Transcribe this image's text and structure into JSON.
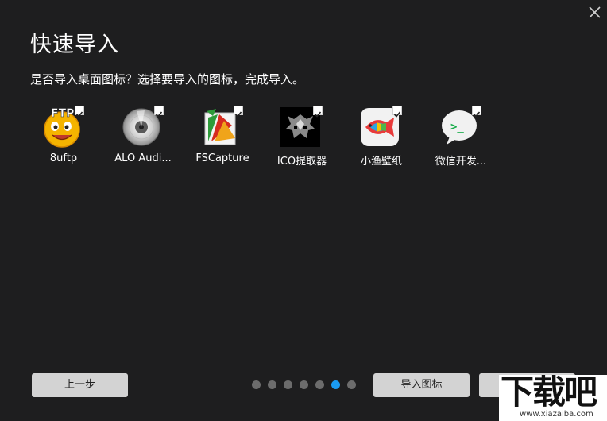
{
  "dialog": {
    "title": "快速导入",
    "subtitle": "是否导入桌面图标？选择要导入的图标，完成导入。"
  },
  "icons": [
    {
      "label": "8uftp",
      "checked": true,
      "icon": "ftp-smiley-icon",
      "overlay_text": "FTP"
    },
    {
      "label": "ALO Audi...",
      "checked": true,
      "icon": "cd-disc-icon"
    },
    {
      "label": "FSCapture",
      "checked": true,
      "icon": "fscapture-icon"
    },
    {
      "label": "ICO提取器",
      "checked": true,
      "icon": "ico-extractor-icon"
    },
    {
      "label": "小渔壁纸",
      "checked": true,
      "icon": "fish-wallpaper-icon"
    },
    {
      "label": "微信开发...",
      "checked": true,
      "icon": "wechat-devtools-icon",
      "overlay_text": ">_"
    }
  ],
  "buttons": {
    "prev": "上一步",
    "import": "导入图标"
  },
  "pagination": {
    "total": 7,
    "active_index": 5
  },
  "watermark": {
    "main": "下载吧",
    "url": "www.xiazaiba.com"
  },
  "colors": {
    "background": "#1e1e1f",
    "button": "#d3d3d3",
    "dot_active": "#1a9bf2",
    "dot_inactive": "#6c6c6c"
  }
}
